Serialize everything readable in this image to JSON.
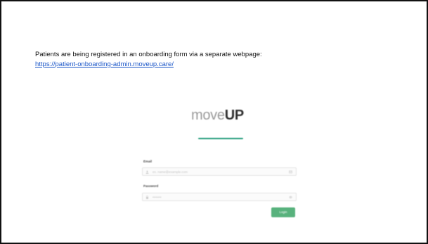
{
  "slide": {
    "description": "Patients are being registered in an onboarding form via a separate webpage:",
    "link_text": "https://patient-onboarding-admin.moveup.care/"
  },
  "login": {
    "logo_part1": "move",
    "logo_part2": "UP",
    "email_label": "Email",
    "email_placeholder": "ex. name@example.com",
    "password_label": "Password",
    "password_placeholder": "••••••••",
    "login_label": "Login"
  },
  "colors": {
    "link": "#1a56c8",
    "brand_accent": "#1e9a78",
    "button": "#58b27d"
  }
}
